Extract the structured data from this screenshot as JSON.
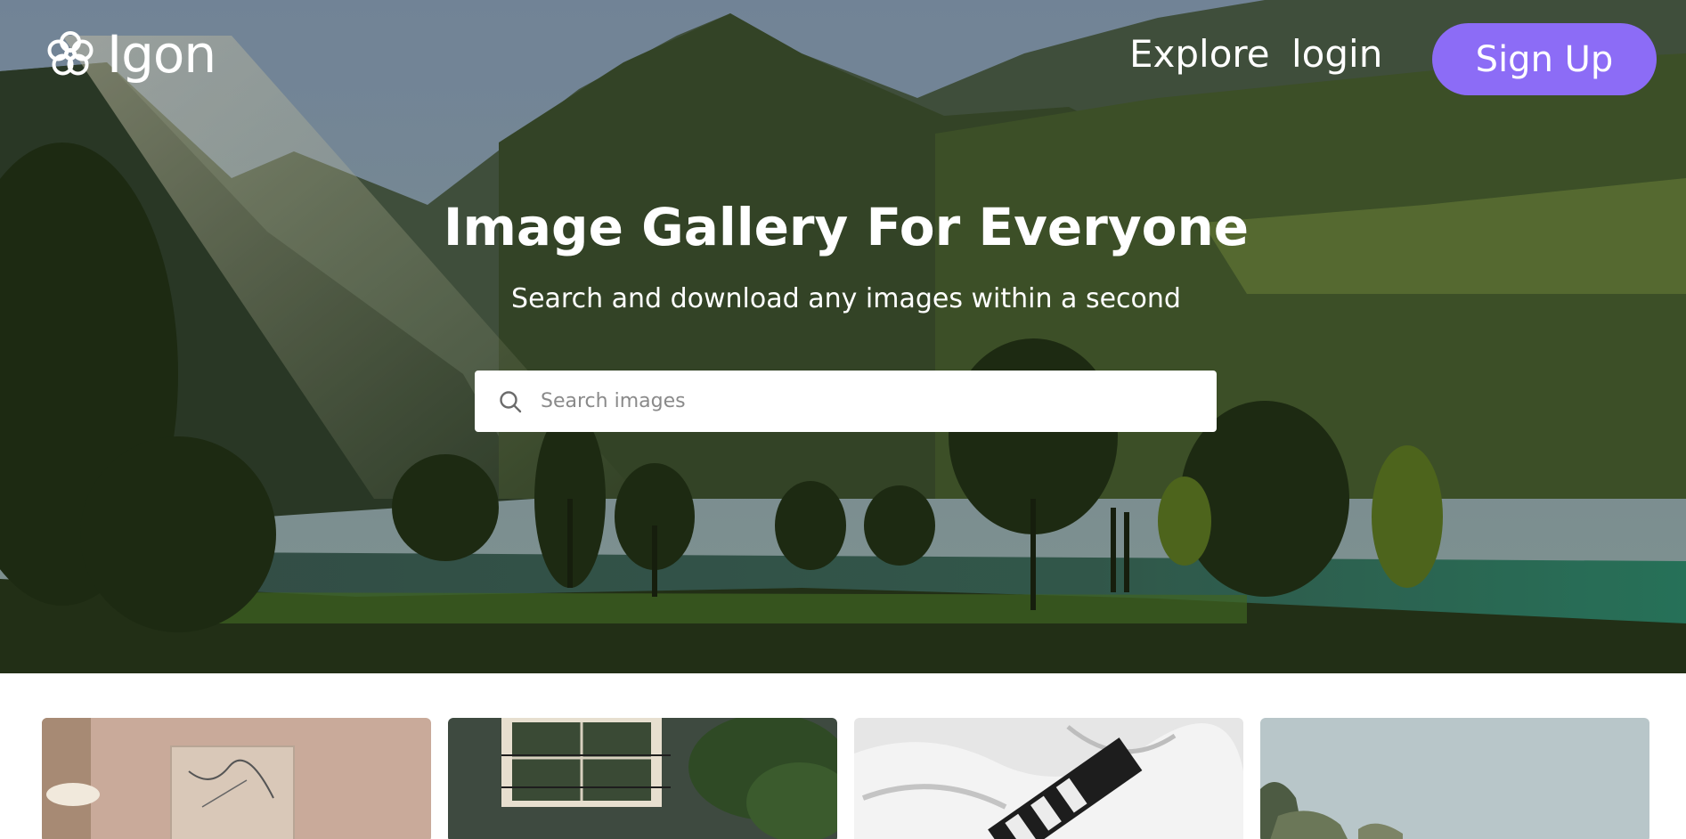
{
  "brand": {
    "name": "Igon",
    "icon": "flower-icon"
  },
  "nav": {
    "explore": "Explore",
    "login": "login",
    "signup": "Sign Up"
  },
  "hero": {
    "title": "Image Gallery For Everyone",
    "subtitle": "Search and download any images within a second",
    "background": "mountain-lake-landscape-photo"
  },
  "search": {
    "placeholder": "Search images",
    "icon": "search-icon"
  },
  "gallery": {
    "images": [
      {
        "subject": "interior-wall-with-art-and-lamp"
      },
      {
        "subject": "window-with-plants"
      },
      {
        "subject": "black-and-white-fabric"
      },
      {
        "subject": "sky-and-trees"
      }
    ]
  },
  "colors": {
    "accent": "#8c6cf6",
    "text_on_hero": "#ffffff",
    "page_background": "#ffffff"
  }
}
